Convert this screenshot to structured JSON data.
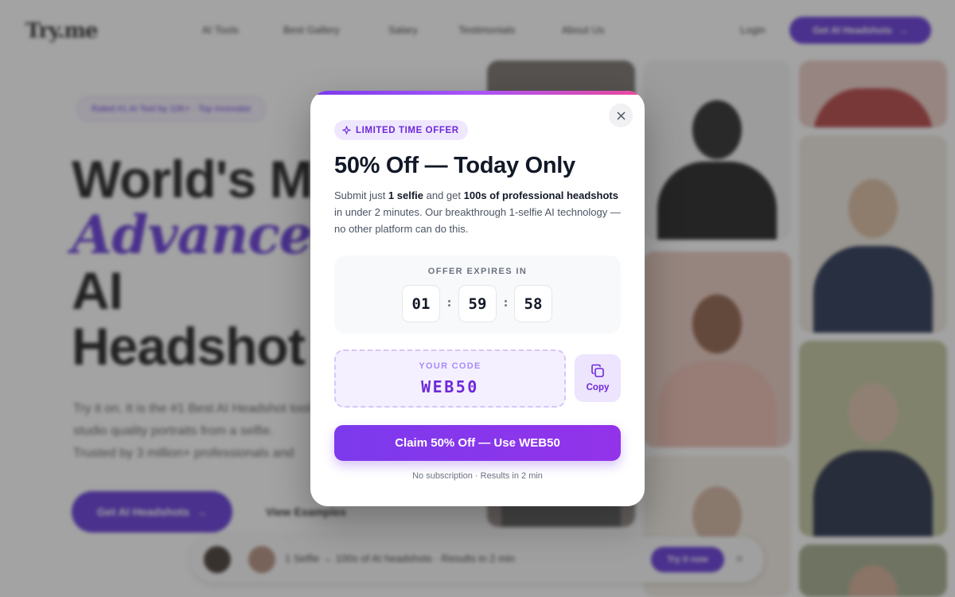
{
  "background": {
    "logo": "Try.me",
    "nav_items": [
      "AI Tools",
      "Best Gallery",
      "Salary",
      "Testimonials",
      "About Us"
    ],
    "login": "Login",
    "nav_cta": "Get AI Headshots",
    "hero_badge": "Rated #1 AI Tool by 10K+ · Top Innovator",
    "hero_line1": "World's M",
    "hero_line2": "Advanced",
    "hero_line3": "AI",
    "hero_line4": "Headshot",
    "hero_sub": "Try it on. It is the #1 Best AI Headshot tool studio quality portraits from a selfie. Trusted by 3 million+ professionals and",
    "hero_btn": "Get AI Headshots",
    "hero_btn2": "View Examples",
    "bottom_bar_text": "1 Selfie → 100s of AI headshots · Results in 2 min",
    "bottom_bar_btn": "Try it now",
    "bottom_bar_close": "×"
  },
  "modal": {
    "badge": "LIMITED TIME OFFER",
    "title": "50% Off — Today Only",
    "desc": {
      "p1": "Submit just ",
      "b1": "1 selfie",
      "p2": " and get ",
      "b2": "100s of professional headshots",
      "p3": " in under 2 minutes. Our breakthrough 1-selfie AI technology — no other platform can do this."
    },
    "timer": {
      "label": "OFFER EXPIRES IN",
      "hours": "01",
      "minutes": "59",
      "seconds": "58",
      "separator": ":"
    },
    "code": {
      "label": "YOUR CODE",
      "value": "WEB50",
      "copy_label": "Copy"
    },
    "claim_button": "Claim 50% Off — Use WEB50",
    "footnote": "No subscription · Results in 2 min",
    "icons": {
      "badge_icon": "sparkle-icon",
      "close_icon": "close-icon",
      "copy_icon": "copy-icon"
    },
    "colors": {
      "accent": "#7c3aed",
      "accent_text": "#6d28d9",
      "gradient_end": "#ec4899"
    }
  }
}
